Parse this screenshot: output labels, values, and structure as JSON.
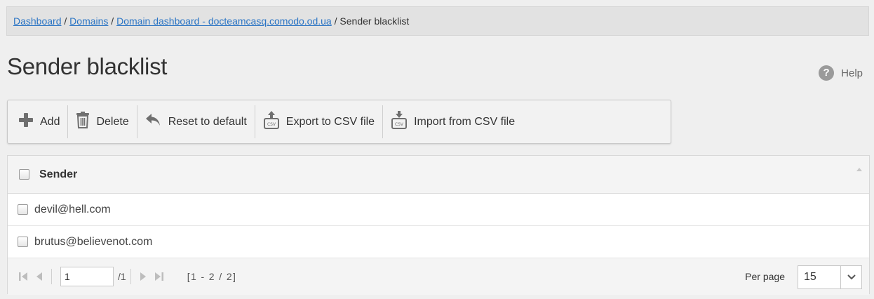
{
  "breadcrumb": {
    "items": [
      {
        "label": "Dashboard",
        "link": true
      },
      {
        "label": "Domains",
        "link": true
      },
      {
        "label": "Domain dashboard - docteamcasq.comodo.od.ua",
        "link": true
      },
      {
        "label": "Sender blacklist",
        "link": false
      }
    ],
    "separator": " / "
  },
  "page": {
    "title": "Sender blacklist",
    "help_label": "Help",
    "help_glyph": "?"
  },
  "toolbar": {
    "add_label": "Add",
    "delete_label": "Delete",
    "reset_label": "Reset to default",
    "export_label": "Export to CSV file",
    "import_label": "Import from CSV file"
  },
  "grid": {
    "column_header": "Sender",
    "rows": [
      {
        "sender": "devil@hell.com"
      },
      {
        "sender": "brutus@believenot.com"
      }
    ]
  },
  "pager": {
    "page_value": "1",
    "page_total": "/1",
    "range": "[1 - 2 / 2]",
    "per_page_label": "Per page",
    "per_page_value": "15"
  },
  "colors": {
    "link": "#2a74c4",
    "icon_gray": "#6f6f6f",
    "disabled_gray": "#bdbdbd"
  },
  "icons": {
    "add": "plus-icon",
    "delete": "trash-icon",
    "reset": "undo-arrow-icon",
    "export": "csv-export-icon",
    "import": "csv-import-icon",
    "help": "question-circle-icon"
  }
}
